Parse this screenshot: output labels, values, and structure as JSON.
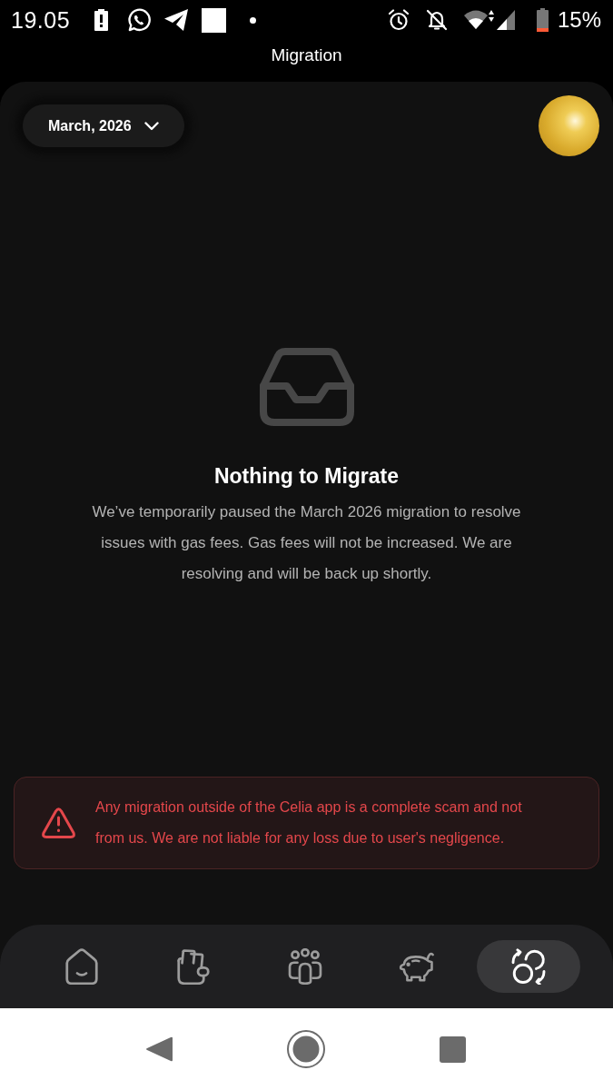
{
  "status_bar": {
    "time": "19.05",
    "battery": "15%"
  },
  "header": {
    "title": "Migration"
  },
  "month_selector": {
    "label": "March, 2026"
  },
  "empty_state": {
    "title": "Nothing to Migrate",
    "message": "We’ve temporarily paused the March 2026 migration to resolve issues with gas fees. Gas fees will not be increased. We are resolving and will be back up shortly."
  },
  "warning": {
    "message": "Any migration outside of the Celia app is a complete scam and not from us. We are not liable for any loss due to user's negligence."
  },
  "bottom_nav": [
    {
      "kind": "home",
      "selected": false
    },
    {
      "kind": "wallet",
      "selected": false
    },
    {
      "kind": "community",
      "selected": false
    },
    {
      "kind": "savings",
      "selected": false
    },
    {
      "kind": "migration",
      "selected": true
    }
  ]
}
